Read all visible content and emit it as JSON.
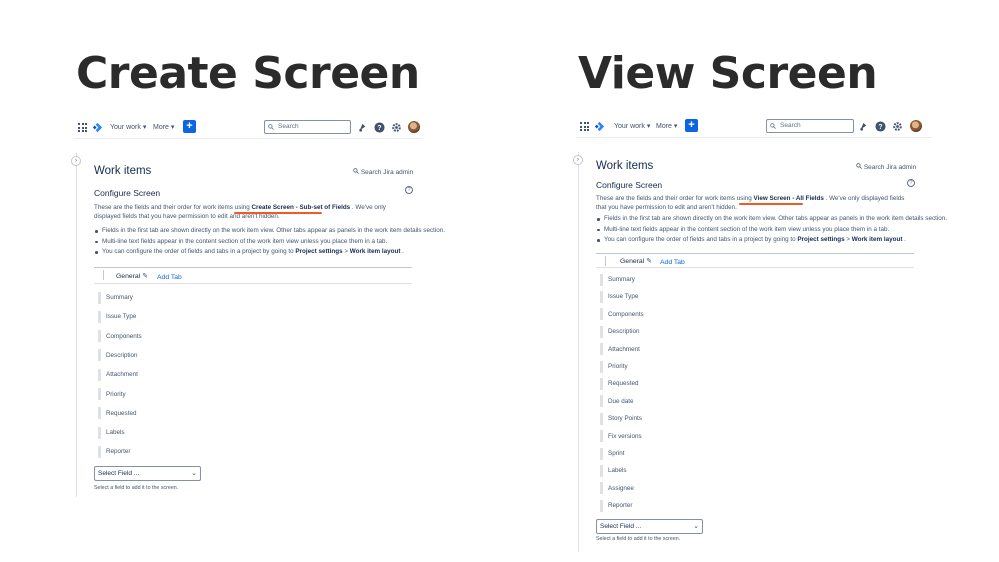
{
  "create": {
    "heading": "Create Screen",
    "topbar": {
      "your_work": "Your work ▾",
      "more": "More ▾",
      "plus": "+",
      "search_placeholder": "Search"
    },
    "collapse": "›",
    "page_title": "Work items",
    "search_admin": "Search Jira admin",
    "section_title": "Configure Screen",
    "help": "?",
    "intro_pre": "These are the fields and their order for work items using ",
    "intro_screen": "Create Screen - Sub-set of Fields",
    "intro_post": " . We've only displayed fields that you have permission to edit and aren't hidden.",
    "bullet_1": "Fields in the first tab are shown directly on the work item view. Other tabs appear as panels in the work item details section.",
    "bullet_2": "Multi-line text fields appear in the content section of the work item view unless you place them in a tab.",
    "bullet_3_pre": "You can configure the order of fields and tabs in a project by going to ",
    "bullet_3_settings": "Project settings",
    "bullet_3_sep": " > ",
    "bullet_3_layout": "Work item layout",
    "bullet_3_post": " .",
    "tab_general": "General",
    "tab_add": "Add Tab",
    "fields": [
      "Summary",
      "Issue Type",
      "Components",
      "Description",
      "Attachment",
      "Priority",
      "Requested",
      "Labels",
      "Reporter"
    ],
    "select_placeholder": "Select Field ...",
    "select_chevron": "⌄",
    "hint": "Select a field to add it to the screen."
  },
  "view": {
    "heading": "View Screen",
    "topbar": {
      "your_work": "Your work ▾",
      "more": "More ▾",
      "plus": "+",
      "search_placeholder": "Search"
    },
    "collapse": "›",
    "page_title": "Work items",
    "search_admin": "Search Jira admin",
    "section_title": "Configure Screen",
    "help": "?",
    "intro_pre": "These are the fields and their order for work items using ",
    "intro_screen": "View Screen - All Fields",
    "intro_post": " . We've only displayed fields that you have permission to edit and aren't hidden.",
    "bullet_1": "Fields in the first tab are shown directly on the work item view. Other tabs appear as panels in the work item details section.",
    "bullet_2": "Multi-line text fields appear in the content section of the work item view unless you place them in a tab.",
    "bullet_3_pre": "You can configure the order of fields and tabs in a project by going to ",
    "bullet_3_settings": "Project settings",
    "bullet_3_sep": " > ",
    "bullet_3_layout": "Work item layout",
    "bullet_3_post": " .",
    "tab_general": "General",
    "tab_add": "Add Tab",
    "fields": [
      "Summary",
      "Issue Type",
      "Components",
      "Description",
      "Attachment",
      "Priority",
      "Requested",
      "Due date",
      "Story Points",
      "Fix versions",
      "Sprint",
      "Labels",
      "Assignee",
      "Reporter"
    ],
    "select_placeholder": "Select Field ...",
    "select_chevron": "⌄",
    "hint": "Select a field to add it to the screen."
  },
  "colors": {
    "accent": "#0c66e4",
    "highlight_underline": "#f15a24",
    "title": "#2b2b2b"
  }
}
